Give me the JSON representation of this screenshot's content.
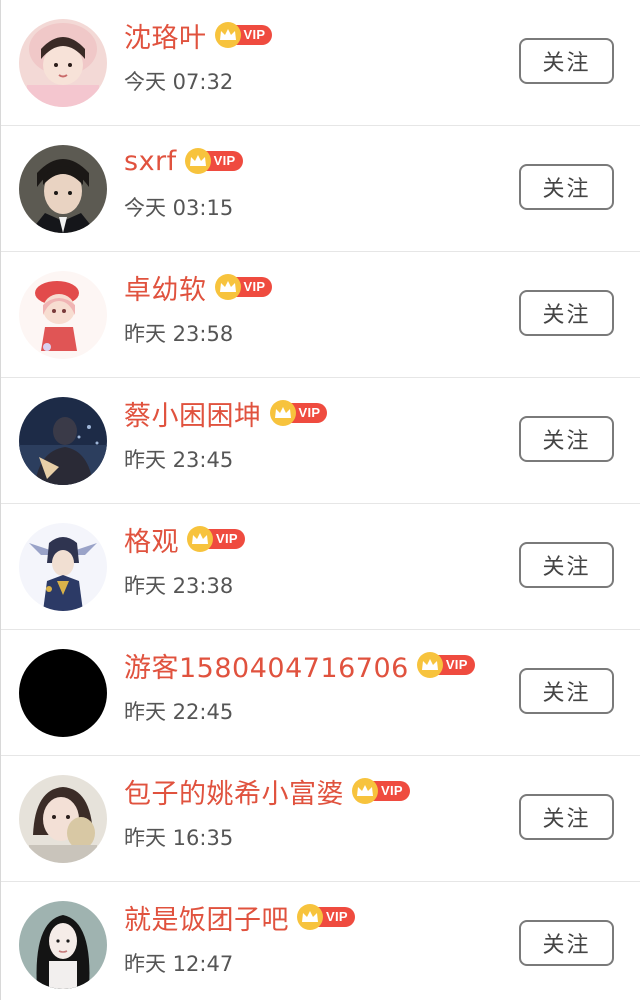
{
  "users": [
    {
      "name": "沈珞叶",
      "time": "今天 07:32",
      "vip": "VIP",
      "follow": "关注",
      "avatar": "girl-pink-hat-avatar"
    },
    {
      "name": "sxrf",
      "time": "今天 03:15",
      "vip": "VIP",
      "follow": "关注",
      "avatar": "boy-suit-avatar"
    },
    {
      "name": "卓幼软",
      "time": "昨天 23:58",
      "vip": "VIP",
      "follow": "关注",
      "avatar": "anime-red-beret-avatar"
    },
    {
      "name": "蔡小困困坤",
      "time": "昨天 23:45",
      "vip": "VIP",
      "follow": "关注",
      "avatar": "night-scene-avatar"
    },
    {
      "name": "格观",
      "time": "昨天 23:38",
      "vip": "VIP",
      "follow": "关注",
      "avatar": "anime-character-avatar"
    },
    {
      "name": "游客1580404716706",
      "time": "昨天 22:45",
      "vip": "VIP",
      "follow": "关注",
      "avatar": "black-avatar"
    },
    {
      "name": "包子的姚希小富婆",
      "time": "昨天 16:35",
      "vip": "VIP",
      "follow": "关注",
      "avatar": "girl-selfie-avatar"
    },
    {
      "name": "就是饭团子吧",
      "time": "昨天 12:47",
      "vip": "VIP",
      "follow": "关注",
      "avatar": "long-hair-girl-avatar"
    }
  ],
  "colors": {
    "name": "#e0523e",
    "vip_tag": "#ef4b3f",
    "vip_crown": "#f7c33d",
    "time": "#555555",
    "follow_border": "#7a7a7a"
  }
}
